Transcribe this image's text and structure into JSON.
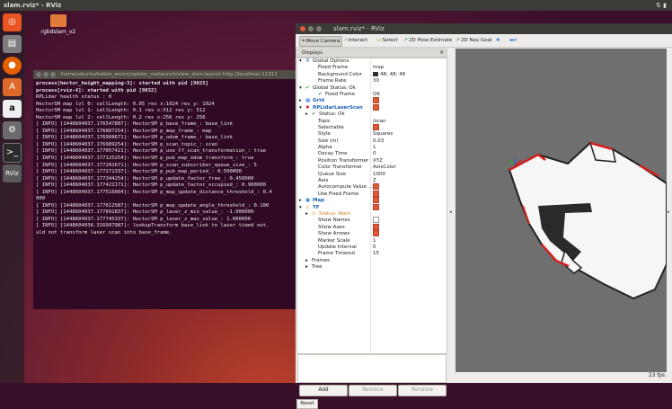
{
  "topbar": {
    "title": "slam.rviz* - RViz",
    "tray": "⇅  ▮"
  },
  "launcher": {
    "items": [
      "ubuntu-dash",
      "files",
      "firefox",
      "software-center",
      "amazon",
      "settings",
      "terminal",
      "rviz"
    ]
  },
  "launcher_rviz_label": "RViz",
  "desktop": {
    "folder_label": "rgbdslam_v2"
  },
  "terminal": {
    "title": "/home/ubuntu/katkin_ws/src/rplidar_ros/launch/view_slam.launch http://localhost:11311",
    "lines": [
      "process[hector_height_mapping-3]: started with pid [9825]",
      "process[rviz-4]: started with pid [9832]",
      "RPLidar health status : 0",
      "HectorSM map lvl 0: cellLength: 0.05 res x:1024 res y: 1024",
      "HectorSM map lvl 1: cellLength: 0.1 res x:512 res y: 512",
      "HectorSM map lvl 2: cellLength: 0.2 res x:256 res y: 256",
      "[ INFO] [1448604037.176547807]: HectorSM p_base_frame_: base_link",
      "[ INFO] [1448604037.176807254]: HectorSM p_map_frame_: map",
      "[ INFO] [1448604037.176908671]: HectorSM p_odom_frame_: base_link",
      "[ INFO] [1448604037.176989254]: HectorSM p_scan_topic_: scan",
      "[ INFO] [1448604037.177057421]: HectorSM p_use_tf_scan_transformation_: true",
      "[ INFO] [1448604037.177125254]: HectorSM p_pub_map_odom_transform_: true",
      "[ INFO] [1448604037.177201671]: HectorSM p_scan_subscriber_queue_size_: 5",
      "[ INFO] [1448604037.177271337]: HectorSM p_pub_map_period_: 0.500000",
      "[ INFO] [1448604037.177344254]: HectorSM p_update_factor_free_: 0.450000",
      "[ INFO] [1448604037.177421171]: HectorSM p_update_factor_occupied_: 0.900000",
      "[ INFO] [1448604037.177516004]: HectorSM p_map_update_distance_threshold_: 0.4",
      "000",
      "[ INFO] [1448604037.177612587]: HectorSM p_map_update_angle_threshold_: 0.100",
      "[ INFO] [1448604037.177691837]: HectorSM p_laser_z_min_value_: -1.000000",
      "[ INFO] [1448604037.177745337]: HectorSM p_laser_z_max_value_: 1.000000",
      "[ INFO] [1448604038.316997987]: lookupTransform base_link to laser timed out.",
      "uld not transform laser scan into base_frame."
    ]
  },
  "rviz": {
    "title": "slam.rviz* - RViz",
    "toolbar": {
      "move_camera": "Move Camera",
      "interact": "Interact",
      "select": "Select",
      "pose_estimate": "2D Pose Estimate",
      "nav_goal": "2D Nav Goal"
    },
    "displays_title": "Displays",
    "rows": [
      {
        "label": "Global Options",
        "indent": 1,
        "arrow": "▾",
        "icon": "gear",
        "value": ""
      },
      {
        "label": "Fixed Frame",
        "indent": 3,
        "arrow": "",
        "icon": "",
        "value": "map"
      },
      {
        "label": "Background Color",
        "indent": 3,
        "arrow": "",
        "icon": "",
        "value": "48; 48; 48",
        "swatch": "#303030"
      },
      {
        "label": "Frame Rate",
        "indent": 3,
        "arrow": "",
        "icon": "",
        "value": "30"
      },
      {
        "label": "Global Status: Ok",
        "indent": 1,
        "arrow": "▾",
        "icon": "ok",
        "value": ""
      },
      {
        "label": "Fixed Frame",
        "indent": 3,
        "arrow": "",
        "icon": "ok",
        "value": "OK"
      },
      {
        "label": "Grid",
        "indent": 1,
        "arrow": "▸",
        "icon": "grid",
        "value": "",
        "check": true,
        "blue": true
      },
      {
        "label": "RPLidarLaserScan",
        "indent": 1,
        "arrow": "▾",
        "icon": "laser",
        "value": "",
        "check": true,
        "blue": true
      },
      {
        "label": "Status: Ok",
        "indent": 2,
        "arrow": "▸",
        "icon": "ok",
        "value": ""
      },
      {
        "label": "Topic",
        "indent": 3,
        "arrow": "",
        "icon": "",
        "value": "/scan"
      },
      {
        "label": "Selectable",
        "indent": 3,
        "arrow": "",
        "icon": "",
        "value": "",
        "check": true
      },
      {
        "label": "Style",
        "indent": 3,
        "arrow": "",
        "icon": "",
        "value": "Squares"
      },
      {
        "label": "Size (m)",
        "indent": 3,
        "arrow": "",
        "icon": "",
        "value": "0.03"
      },
      {
        "label": "Alpha",
        "indent": 3,
        "arrow": "",
        "icon": "",
        "value": "1"
      },
      {
        "label": "Decay Time",
        "indent": 3,
        "arrow": "",
        "icon": "",
        "value": "0"
      },
      {
        "label": "Position Transformer",
        "indent": 3,
        "arrow": "",
        "icon": "",
        "value": "XYZ"
      },
      {
        "label": "Color Transformer",
        "indent": 3,
        "arrow": "",
        "icon": "",
        "value": "AxisColor"
      },
      {
        "label": "Queue Size",
        "indent": 3,
        "arrow": "",
        "icon": "",
        "value": "1000"
      },
      {
        "label": "Axis",
        "indent": 3,
        "arrow": "",
        "icon": "",
        "value": "Z"
      },
      {
        "label": "Autocompute Value ...",
        "indent": 3,
        "arrow": "",
        "icon": "",
        "value": "",
        "check": true
      },
      {
        "label": "Use Fixed Frame",
        "indent": 3,
        "arrow": "",
        "icon": "",
        "value": "",
        "check": true
      },
      {
        "label": "Map",
        "indent": 1,
        "arrow": "▸",
        "icon": "map",
        "value": "",
        "check": true,
        "blue": true
      },
      {
        "label": "TF",
        "indent": 1,
        "arrow": "▾",
        "icon": "warn",
        "value": "",
        "check": true,
        "blue": true
      },
      {
        "label": "Status: Warn",
        "indent": 2,
        "arrow": "▸",
        "icon": "warn",
        "value": "",
        "orange": true
      },
      {
        "label": "Show Names",
        "indent": 3,
        "arrow": "",
        "icon": "",
        "value": "",
        "check": false
      },
      {
        "label": "Show Axes",
        "indent": 3,
        "arrow": "",
        "icon": "",
        "value": "",
        "check": true
      },
      {
        "label": "Show Arrows",
        "indent": 3,
        "arrow": "",
        "icon": "",
        "value": "",
        "check": true
      },
      {
        "label": "Marker Scale",
        "indent": 3,
        "arrow": "",
        "icon": "",
        "value": "1"
      },
      {
        "label": "Update Interval",
        "indent": 3,
        "arrow": "",
        "icon": "",
        "value": "0"
      },
      {
        "label": "Frame Timeout",
        "indent": 3,
        "arrow": "",
        "icon": "",
        "value": "15"
      },
      {
        "label": "Frames",
        "indent": 2,
        "arrow": "▸",
        "icon": "",
        "value": ""
      },
      {
        "label": "Tree",
        "indent": 2,
        "arrow": "▸",
        "icon": "",
        "value": ""
      }
    ],
    "buttons": {
      "add": "Add",
      "remove": "Remove",
      "rename": "Rename"
    },
    "reset": "Reset",
    "fps": "23 fps"
  },
  "colors": {
    "accent": "#e05a3a",
    "terminal_bg": "#300a24",
    "view_bg": "#6f6f6f"
  }
}
